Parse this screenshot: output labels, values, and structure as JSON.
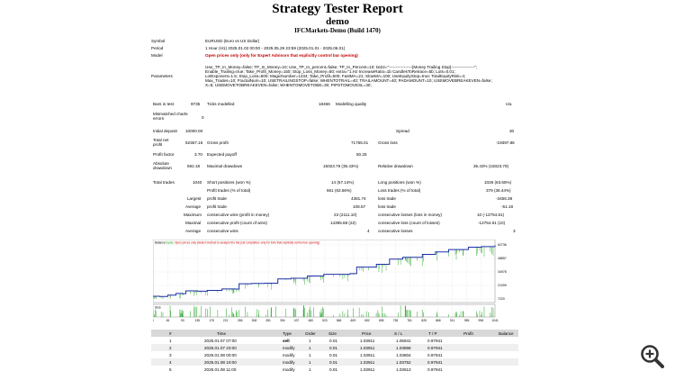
{
  "header": {
    "title": "Strategy Tester Report",
    "subtitle": "demo",
    "broker": "IFCMarkets-Demo (Build 1470)"
  },
  "settings": [
    {
      "label": "Symbol",
      "value": "EURUSD (Euro vs US Dollar)",
      "style": "normal"
    },
    {
      "label": "Period",
      "value": "1 Hour (H1) 2025.01.02 00:00 - 2025.05.29 23:59 (2025.01.01 - 2025.06.01)",
      "style": "normal"
    },
    {
      "label": "Model",
      "value": "Open prices only (only for Expert Advisors that explicitly control bar opening)",
      "style": "red"
    }
  ],
  "parameters": {
    "label": "Parameters",
    "lines": [
      "Use_TP_In_Money=false; TP_In_Money=10; Use_TP_In_percent=false; TP_In_Percent=10; txt22=\"-----------------[Money Trailing Stop]-----------------\";",
      "Enable_Trailing=true; Take_Profit_Money=150; Stop_Loss_Money=50; extra=\"1.Hz IncreaseRatio=1b CandlesToRetrace=5b; Lots=0.01;",
      "LotExponent=1.5; Stop_Loss=500; MagicNumber=1234; Take_Profit=500; FastMA=21; SlowMA=100; UseEquityStop=true; TotalEquityRisk=4;",
      "Max_Trades=10; FractalNum=10; USETRAILINGSTOP=false; WHENTOTRAIL=40; TRAILAMOUNT=40; PADAMOUNT=10; USEMOVEBREAKEVEN=false;",
      "X=5; USEMOVETOBREAKEVEN=false; WHENTOMOVETOBE=30; PIPSTOMOVESL=30;"
    ]
  },
  "quality": {
    "bars_label": "Bars in test",
    "bars_value": "9735",
    "ticks_label": "Ticks modelled",
    "ticks_value": "18466",
    "quality_label": "Modelling quality",
    "quality_value": "n/a",
    "mismatch_label": "Mismatched charts errors",
    "mismatch_value": "0"
  },
  "results": {
    "initial_deposit_label": "Initial deposit",
    "initial_deposit": "10000.00",
    "spread_label": "Spread",
    "spread": "30",
    "net_profit_label": "Total net profit",
    "net_profit": "52367.16",
    "gross_profit_label": "Gross profit",
    "gross_profit": "71765.01",
    "gross_loss_label": "Gross loss",
    "gross_loss": "-19397.86",
    "profit_factor_label": "Profit factor",
    "profit_factor": "3.70",
    "expected_payoff_label": "Expected payoff",
    "expected_payoff": "50.25",
    "abs_dd_label": "Absolute drawdown",
    "abs_dd": "592.18",
    "max_dd_label": "Maximal drawdown",
    "max_dd": "15023.79 (35.43%)",
    "rel_dd_label": "Relative drawdown",
    "rel_dd": "35.43% (15023.79)",
    "total_trades_label": "Total trades",
    "total_trades": "1040",
    "short_label": "Short positions (won %)",
    "short": "14 (57.14%)",
    "long_label": "Long positions (won %)",
    "long": "1026 (63.65%)",
    "profit_trades_label": "Profit trades (% of total)",
    "profit_trades": "661 (63.56%)",
    "loss_trades_label": "Loss trades (% of total)",
    "loss_trades": "379 (36.44%)",
    "largest_label": "Largest",
    "largest_profit_label": "profit trade",
    "largest_profit": "4381.74",
    "largest_loss_label": "loss trade",
    "largest_loss": "-3456.38",
    "average_label": "Average",
    "avg_profit_label": "profit trade",
    "avg_profit": "108.57",
    "avg_loss_label": "loss trade",
    "avg_loss": "-51.18",
    "maximum_label": "Maximum",
    "max_wins_label": "consecutive wins (profit in money)",
    "max_wins": "23 (2111.10)",
    "max_losses_label": "consecutive losses (loss in money)",
    "max_losses": "10 (-12754.61)",
    "maximal_label": "Maximal",
    "maxl_profit_label": "consecutive profit (count of wins)",
    "maxl_profit": "14395.88 (22)",
    "maxl_loss_label": "consecutive loss (count of losses)",
    "maxl_loss": "-12754.61 (10)",
    "average2_label": "Average",
    "avg_wins_label": "consecutive wins",
    "avg_wins": "4",
    "avg_losses_label": "consecutive losses",
    "avg_losses": "3"
  },
  "chart_data": {
    "type": "line",
    "legend": [
      "Balance",
      "Equity",
      "Open prices only (Select method to analyze the bar just completed, only for EAs that explicitly control bar opening)"
    ],
    "colors": {
      "balance": "#1c2fa6",
      "equity": "#22a522",
      "size": "#22a522",
      "legend_red": "#d00000"
    },
    "y_ticks": [
      "62736",
      "48857",
      "34978",
      "21099",
      "7220"
    ],
    "ylim": [
      7220,
      62736
    ],
    "x_ticks": [
      "0",
      "45",
      "90",
      "135",
      "178",
      "221",
      "265",
      "308",
      "351",
      "394",
      "437",
      "480",
      "523",
      "566",
      "609",
      "652",
      "695",
      "738",
      "781",
      "825",
      "868",
      "911",
      "955",
      "998",
      "1041"
    ],
    "size_label": "Size",
    "balance_points": [
      [
        0,
        10000
      ],
      [
        20,
        9800
      ],
      [
        45,
        11200
      ],
      [
        70,
        12900
      ],
      [
        90,
        12600
      ],
      [
        100,
        15500
      ],
      [
        135,
        15200
      ],
      [
        165,
        16000
      ],
      [
        210,
        17500
      ],
      [
        250,
        17400
      ],
      [
        262,
        22800
      ],
      [
        300,
        23200
      ],
      [
        340,
        23400
      ],
      [
        380,
        27800
      ],
      [
        420,
        28500
      ],
      [
        470,
        30800
      ],
      [
        520,
        32600
      ],
      [
        600,
        33200
      ],
      [
        620,
        40000
      ],
      [
        680,
        42800
      ],
      [
        720,
        48200
      ],
      [
        760,
        50000
      ],
      [
        820,
        53000
      ],
      [
        860,
        55600
      ],
      [
        900,
        58000
      ],
      [
        960,
        60400
      ],
      [
        1000,
        61000
      ],
      [
        1041,
        62366
      ]
    ]
  },
  "table": {
    "headers": [
      "#",
      "Time",
      "Type",
      "Order",
      "Size",
      "Price",
      "S / L",
      "T / P",
      "Profit",
      "Balance"
    ],
    "rows": [
      [
        "1",
        "2025.01.07 07:00",
        "sell",
        "1",
        "0.01",
        "1.03911",
        "1.05941",
        "0.97941",
        "",
        ""
      ],
      [
        "2",
        "2025.01.07 23:00",
        "modify",
        "1",
        "0.01",
        "1.03911",
        "1.03868",
        "0.97941",
        "",
        ""
      ],
      [
        "3",
        "2025.01.08 00:00",
        "modify",
        "1",
        "0.01",
        "1.03911",
        "1.03804",
        "0.97941",
        "",
        ""
      ],
      [
        "4",
        "2025.01.08 10:00",
        "modify",
        "1",
        "0.01",
        "1.03911",
        "1.03752",
        "0.97941",
        "",
        ""
      ],
      [
        "5",
        "2025.01.08 11:00",
        "modify",
        "1",
        "0.01",
        "1.03911",
        "1.03613",
        "0.97941",
        "",
        ""
      ]
    ]
  },
  "zoom_icon": "zoom-in-icon"
}
